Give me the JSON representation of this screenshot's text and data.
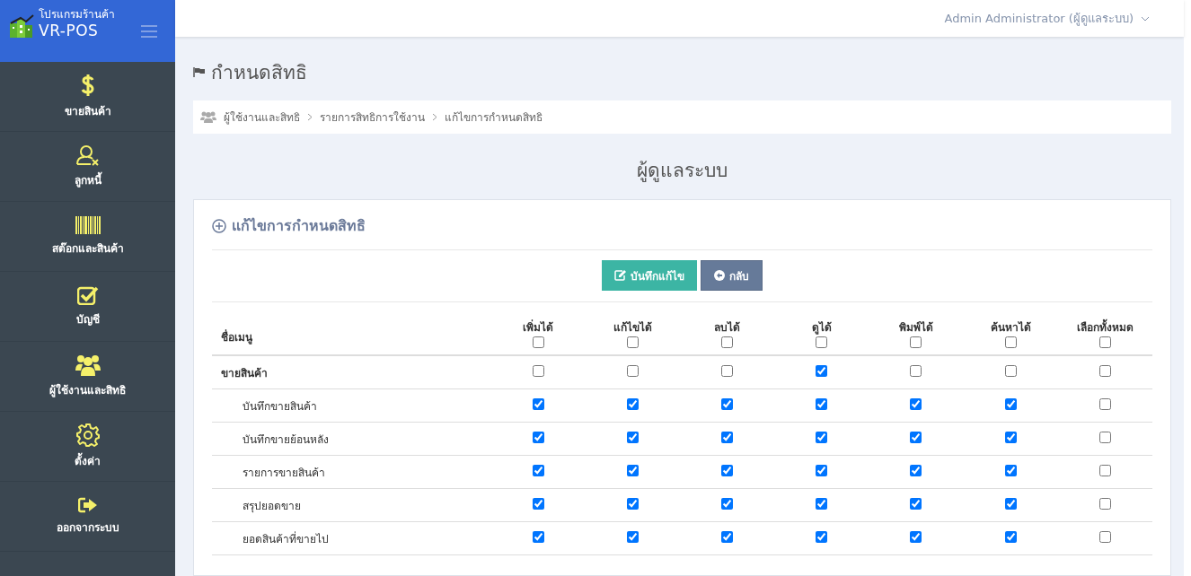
{
  "brand": {
    "subtitle": "โปรแกรมร้านค้า",
    "name": "VR-POS"
  },
  "user_menu": {
    "label": "Admin Administrator (ผู้ดูแลระบบ)"
  },
  "sidebar": {
    "items": [
      {
        "label": "ขายสินค้า"
      },
      {
        "label": "ลูกหนี้"
      },
      {
        "label": "สต๊อกและสินค้า"
      },
      {
        "label": "บัญชี"
      },
      {
        "label": "ผู้ใช้งานและสิทธิ"
      },
      {
        "label": "ตั้งค่า"
      },
      {
        "label": "ออกจากระบบ"
      }
    ]
  },
  "page_title": "กำหนดสิทธิ",
  "breadcrumb": [
    "ผู้ใช้งานและสิทธิ",
    "รายการสิทธิการใช้งาน",
    "แก้ไขการกำหนดสิทธิ"
  ],
  "role_title": "ผู้ดูแลระบบ",
  "card": {
    "title": "แก้ไขการกำหนดสิทธิ",
    "buttons": [
      {
        "label": "บันทึกแก้ไข",
        "kind": "save"
      },
      {
        "label": "กลับ",
        "kind": "back"
      }
    ],
    "table": {
      "name_column": "ชื่อเมนู",
      "columns": [
        {
          "label": "เพิ่มได้",
          "checked": false
        },
        {
          "label": "แก้ไขได้",
          "checked": false
        },
        {
          "label": "ลบได้",
          "checked": false
        },
        {
          "label": "ดูได้",
          "checked": false
        },
        {
          "label": "พิมพ์ได้",
          "checked": false
        },
        {
          "label": "ค้นหาได้",
          "checked": false
        },
        {
          "label": "เลือกทั้งหมด",
          "checked": false
        }
      ],
      "rows": [
        {
          "name": "ขายสินค้า",
          "kind": "group",
          "checks": [
            false,
            false,
            false,
            true,
            false,
            false,
            false
          ]
        },
        {
          "name": "บันทึกขายสินค้า",
          "kind": "item",
          "checks": [
            true,
            true,
            true,
            true,
            true,
            true,
            false
          ]
        },
        {
          "name": "บันทึกขายย้อนหลัง",
          "kind": "item",
          "checks": [
            true,
            true,
            true,
            true,
            true,
            true,
            false
          ]
        },
        {
          "name": "รายการขายสินค้า",
          "kind": "item",
          "checks": [
            true,
            true,
            true,
            true,
            true,
            true,
            false
          ]
        },
        {
          "name": "สรุปยอดขาย",
          "kind": "item",
          "checks": [
            true,
            true,
            true,
            true,
            true,
            true,
            false
          ]
        },
        {
          "name": "ยอดสินค้าที่ขายไป",
          "kind": "item",
          "checks": [
            true,
            true,
            true,
            true,
            true,
            true,
            false
          ]
        }
      ]
    }
  }
}
